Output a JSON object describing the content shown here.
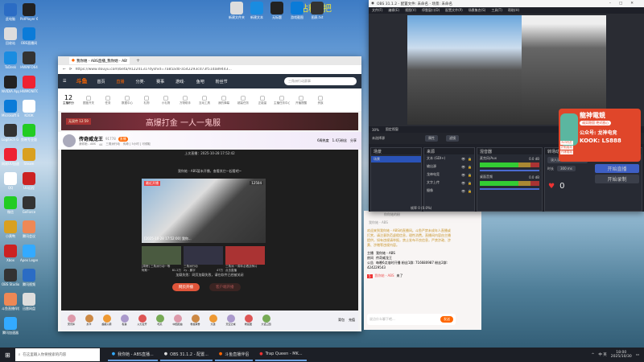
{
  "desktop": {
    "icons_left": [
      "此电脑",
      "回收站",
      "ToDesk",
      "NVIDIA App",
      "Microsoft Edge",
      "Logitech G HUB",
      "网易UU加速器",
      "QQ",
      "微信",
      "小黄鸭",
      "Xbox",
      "OBS Studio",
      "斗鱼直播伴侣",
      "腾讯加速器"
    ],
    "icons_right": [
      "PotPlayer 64 bit",
      "OBS直播间",
      "HWiNFO64",
      "HWMONITOR",
      "KOOK",
      "剪映专业版",
      "Steam",
      "UU远程",
      "GeForce",
      "腾讯会议",
      "Apex Legends",
      "腾讯视频",
      "迅雷网盘"
    ],
    "top_icons": [
      "新建文件夹",
      "新建文本",
      "无标题",
      "游戏截图",
      "图表.txt"
    ],
    "overlay_text": "钻粉3把"
  },
  "browser": {
    "tab_title": "我你她 - ABS直播_我你她 - ABS",
    "url": "https://www.douyu.com/beta/91224131?dyshid=7a85ad0-a542293cd73f51da89443...",
    "nav": [
      "首页",
      "直播",
      "分类·",
      "赛事",
      "游戏·",
      "鱼吧",
      "粉丝节"
    ],
    "search_placeholder": "三角洲行动赛事",
    "toolbar": {
      "level": "12",
      "level_label": "主播积分",
      "items": [
        "图鉴开关",
        "任务",
        "数据中心",
        "礼物",
        "小礼物",
        "万物助手",
        "互动工具",
        "我的弹幕",
        "超高任务",
        "正能量",
        "主播任务中心",
        "开播提醒",
        "贵族"
      ]
    },
    "banner": {
      "left": "无双传 12:59",
      "slogan": "高爆打金 一人一鬼服"
    },
    "streamer": {
      "name": "传奇威龙王",
      "id": "91778",
      "badge": "直播",
      "category": "我你她 - ABS",
      "viewers": "44",
      "tags": "三角洲行动",
      "rank": "传奇 [ 5小时 ] 可领取",
      "follow": "1.4万粉丝",
      "fans": "6周热度",
      "share": "分享"
    },
    "video": {
      "last_live": "上次直播：2025-10-28 17:52:42",
      "notice": "我你她 - ABS暂未开播，查看其它一起看吧~",
      "preview_badge": "最近开播",
      "preview_count": "12504",
      "preview_caption": "[2025-10-28 17:52:00] 我你...",
      "recommend": [
        {
          "title": "[周榜] 三角洲行动一等",
          "author": "阿斯~",
          "views": "81.2万"
        },
        {
          "title": "三角洲行动",
          "author": "2y - 鹏宇",
          "views": "47万"
        },
        {
          "title": "三角洲 一周年必看战争片",
          "author": "点击直播",
          "views": ""
        }
      ],
      "fail_text": "加载失败：网页加载失败，请在软件已经被关闭",
      "btn_web": "网页开播",
      "btn_client": "客户端开播"
    },
    "gifts": [
      "荧光棒",
      "办卡",
      "超级火箭",
      "私信",
      "火力全开",
      "吃瓜",
      "中国加油",
      "粉丝荣誉",
      "大鼓",
      "天空之城",
      "粉丝团",
      "大话三国"
    ],
    "bottom_right": [
      "背包",
      "充值"
    ]
  },
  "chat": {
    "header": "你你她的粉",
    "sender": "我你她 - ABS",
    "welcome": "欢迎来到我你她 - ABS的直播间。斗鱼严禁未成年人直播或打赏，请注意防范虚假信息，理性消费。直播间内容由主播提供，如有违规请举报，禁止发布不良信息，严禁涉政、涉黄、涉赌等违规内容。",
    "lines": [
      {
        "k": "主播",
        "v": "我你她 - ABS"
      },
      {
        "k": "房间",
        "v": "传奇威龙王"
      },
      {
        "k": "公告",
        "v": "每晚6点准时开播 粉丝1群: 716680987 粉丝2群: 424229543"
      }
    ],
    "joined_user": "我你她 - ABS",
    "joined_text": "来了",
    "input_placeholder": "说点什么聊下吧...",
    "send": "发送"
  },
  "obs": {
    "title": "OBS 31.1.2 - 配置文件: 未命名 - 场景: 未命名",
    "menu": [
      "文件(F)",
      "编辑(E)",
      "视图(V)",
      "停靠窗口(D)",
      "配置文件(P)",
      "场景集合(S)",
      "工具(T)",
      "帮助(H)"
    ],
    "toolbar": [
      "30%",
      "固定视窗"
    ],
    "scene_header": "未选择源",
    "props": "属性",
    "filters": "滤镜",
    "docks": {
      "scenes": "场景",
      "sources": "来源",
      "mixer": "混音器",
      "transition": "转场动画",
      "controls": "控制"
    },
    "scene_items": [
      "场景"
    ],
    "sources": [
      "文本 (GDI+)",
      "输出源",
      "龙神电竞",
      "文字上传",
      "摄像"
    ],
    "mixer": [
      {
        "name": "麦克风/Aux",
        "db": "0.0 dB"
      },
      {
        "name": "桌面音频",
        "db": "0.0 dB"
      }
    ],
    "transition": {
      "type": "淡入淡出",
      "duration_label": "时长",
      "duration": "300 ms"
    },
    "controls": [
      "开始直播",
      "开始录制"
    ],
    "status": "帧率 0 (0.0%)",
    "heart_count": "0"
  },
  "ad": {
    "brand": "龍神電競",
    "line1": "诚实稳固 绝对放心",
    "tags": [
      "3V3代打",
      "护航陪玩",
      "代练陪玩"
    ],
    "gzh": "公众号: 龙神电竞",
    "kook": "KOOK: LS888"
  },
  "taskbar": {
    "search": "在这里输入你要搜索的内容",
    "apps": [
      "我你她 - ABS直播...",
      "OBS 31.1.2 - 配置...",
      "斗鱼直播伴侣",
      "Trap Queen - MK..."
    ],
    "time": "18:00",
    "date": "2025/10/30",
    "lang": "中 英"
  }
}
